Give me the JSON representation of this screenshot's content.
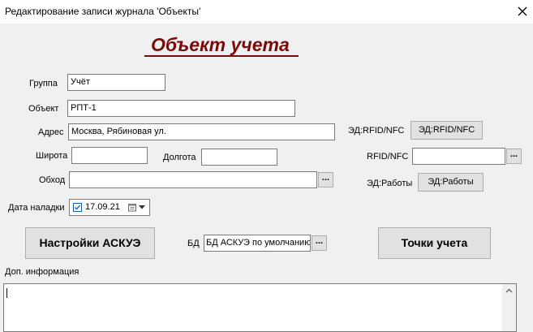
{
  "window": {
    "title": "Редактирование записи журнала 'Объекты'"
  },
  "heading": "Объект учета",
  "fields": {
    "group": {
      "label": "Группа",
      "value": "Учёт"
    },
    "object": {
      "label": "Объект",
      "value": "РПТ-1"
    },
    "address": {
      "label": "Адрес",
      "value": "Москва, Рябиновая ул."
    },
    "latitude": {
      "label": "Широта",
      "value": ""
    },
    "longitude": {
      "label": "Долгота",
      "value": ""
    },
    "bypass": {
      "label": "Обход",
      "value": ""
    },
    "setup_date": {
      "label": "Дата наладки",
      "value": "17.09.21",
      "checked": true
    },
    "rfid": {
      "label": "RFID/NFC",
      "value": ""
    },
    "db": {
      "label": "БД",
      "value": "БД АСКУЭ по умолчанию"
    },
    "extra_info": {
      "label": "Доп. информация",
      "value": ""
    }
  },
  "ed_rfid": {
    "label": "ЭД:RFID/NFC",
    "button": "ЭД:RFID/NFC"
  },
  "ed_work": {
    "label": "ЭД:Работы",
    "button": "ЭД:Работы"
  },
  "buttons": {
    "askue_settings": "Настройки АСКУЭ",
    "metering_points": "Точки учета",
    "ellipsis": "..."
  },
  "icons": {
    "close": "close-icon",
    "calendar": "calendar-icon",
    "dropdown": "chevron-down-icon",
    "check": "check-icon"
  },
  "colors": {
    "heading": "#7a0a0a",
    "checkbox": "#1f5faa"
  }
}
